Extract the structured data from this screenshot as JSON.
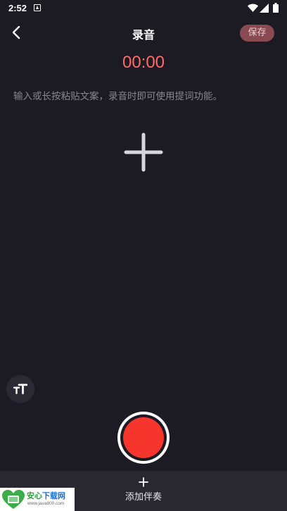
{
  "status_bar": {
    "time": "2:52"
  },
  "header": {
    "title": "录音",
    "save_label": "保存"
  },
  "recording": {
    "timer": "00:00"
  },
  "script_area": {
    "placeholder_hint": "输入或长按粘贴文案，录音时即可使用提词功能。"
  },
  "bottom_bar": {
    "add_accompaniment_label": "添加伴奏"
  },
  "watermark": {
    "title_part1": "安心",
    "title_part2": "下载网",
    "url": "www.java800.com"
  },
  "icons": {
    "back": "chevron-left-icon",
    "add_text": "plus-icon",
    "font_size": "text-size-icon",
    "record": "record-icon",
    "add_accompaniment": "plus-icon"
  },
  "colors": {
    "background": "#1c1b24",
    "timer": "#ff6b63",
    "save_button_bg": "#8a4a51",
    "record": "#f6352d",
    "bottom_bar": "#292831"
  }
}
